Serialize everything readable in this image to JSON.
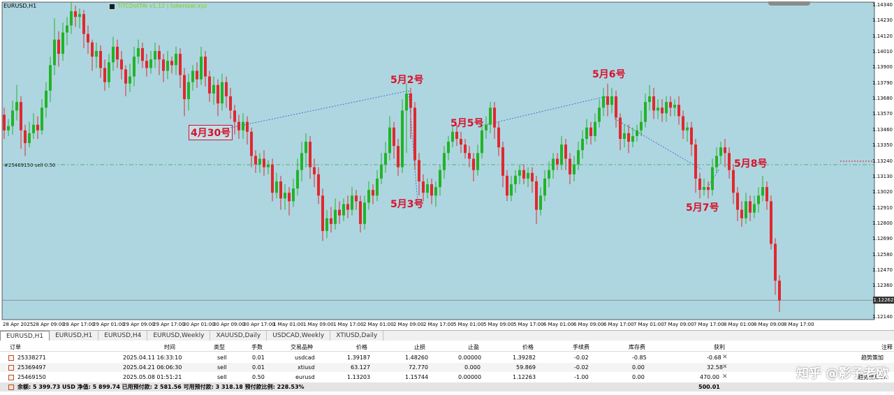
{
  "chart": {
    "title": "EURUSD,H1",
    "ea_label": "TiTCDotTAI v1.12 | tokenizer.xyz",
    "order_label": "#25469150 sell 0.50",
    "bg": "#aed6e1",
    "bull": "#22b326",
    "bear": "#e0282e",
    "y_ticks": [
      "1.14340",
      "1.14230",
      "1.14120",
      "1.14010",
      "1.13900",
      "1.13790",
      "1.13680",
      "1.13570",
      "1.13460",
      "1.13350",
      "1.13240",
      "1.13130",
      "1.13020",
      "1.12910",
      "1.12800",
      "1.12690",
      "1.12580",
      "1.12470",
      "1.12360",
      "1.12262",
      "1.12140"
    ],
    "current_price": "1.12262",
    "x_ticks": [
      "28 Apr 2025",
      "28 Apr 09:00",
      "28 Apr 17:00",
      "29 Apr 01:00",
      "29 Apr 09:00",
      "29 Apr 17:00",
      "30 Apr 01:00",
      "30 Apr 09:00",
      "30 Apr 17:00",
      "1 May 01:00",
      "1 May 09:00",
      "1 May 17:00",
      "2 May 01:00",
      "2 May 09:00",
      "2 May 17:00",
      "5 May 01:00",
      "5 May 09:00",
      "5 May 17:00",
      "6 May 01:00",
      "6 May 09:00",
      "6 May 17:00",
      "7 May 01:00",
      "7 May 09:00",
      "7 May 17:00",
      "8 May 01:00",
      "8 May 09:00",
      "8 May 17:00"
    ],
    "annotations": [
      "4月30号",
      "5月2号",
      "5月3号",
      "5月5号",
      "5月6号",
      "5月7号",
      "5月8号"
    ]
  },
  "tabs": [
    "EURUSD,H1",
    "EURUSD,H1",
    "EURUSD,H4",
    "EURUSD,Weekly",
    "XAUUSD,Daily",
    "USDCAD,Weekly",
    "XTIUSD,Daily"
  ],
  "orders": {
    "headers": [
      "订单",
      "时间",
      "类型",
      "手数",
      "交易品种",
      "价格",
      "止损",
      "止盈",
      "价格",
      "手续费",
      "库存费",
      "获利",
      "注释"
    ],
    "rows": [
      {
        "ticket": "25338271",
        "time": "2025.04.11 16:33:10",
        "type": "sell",
        "lots": "0.01",
        "symbol": "usdcad",
        "open": "1.39187",
        "sl": "1.48260",
        "tp": "0.00000",
        "price": "1.39282",
        "commission": "-0.02",
        "swap": "-0.85",
        "profit": "-0.68",
        "comment": "趋势策加"
      },
      {
        "ticket": "25369497",
        "time": "2025.04.21 06:06:30",
        "type": "sell",
        "lots": "0.01",
        "symbol": "xtiusd",
        "open": "63.127",
        "sl": "72.770",
        "tp": "0.000",
        "price": "59.869",
        "commission": "-0.02",
        "swap": "0.00",
        "profit": "32.58",
        "comment": ""
      },
      {
        "ticket": "25469150",
        "time": "2025.05.08 01:51:21",
        "type": "sell",
        "lots": "0.50",
        "symbol": "eurusd",
        "open": "1.13203",
        "sl": "1.15744",
        "tp": "0.00000",
        "price": "1.12263",
        "commission": "-1.00",
        "swap": "0.00",
        "profit": "470.00",
        "comment": "趋势做单1h"
      }
    ],
    "summary": "余额: 5 399.73 USD  净值: 5 899.74  已用预付款: 2 581.56  可用预付款: 3 318.18  预付款比例: 228.53%",
    "total_profit": "500.01"
  },
  "watermark": "知乎 @影子老欧"
}
